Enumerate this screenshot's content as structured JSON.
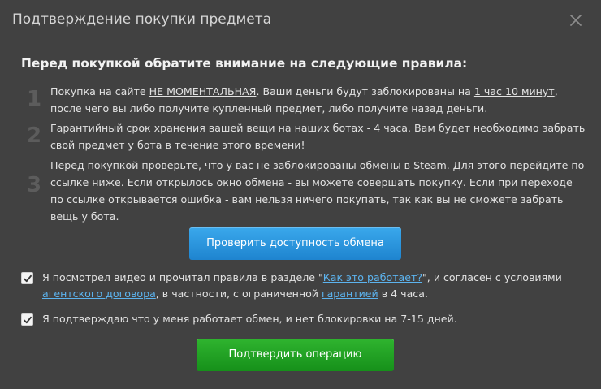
{
  "dialog": {
    "title": "Подтверждение покупки предмета",
    "close_icon": "close-icon"
  },
  "rules": {
    "heading": "Перед покупкой обратите внимание на следующие правила:",
    "items": [
      {
        "number": "1",
        "parts": [
          "Покупка на сайте ",
          "НЕ МОМЕНТАЛЬНАЯ",
          ". Ваши деньги будут заблокированы на ",
          "1 час 10 минут",
          ", после чего вы либо получите купленный предмет, либо получите назад деньги."
        ]
      },
      {
        "number": "2",
        "text": "Гарантийный срок хранения вашей вещи на наших ботах - 4 часа. Вам будет необходимо забрать свой предмет у бота в течение этого времени!"
      },
      {
        "number": "3",
        "text": "Перед покупкой проверьте, что у вас не заблокированы обмены в Steam. Для этого перейдите по ссылке ниже. Если открылось окно обмена - вы можете совершать покупку. Если при переходе по ссылке открывается ошибка - вам нельзя ничего покупать, так как вы не сможете забрать вещь у бота."
      }
    ]
  },
  "check_trade_button": "Проверить доступность обмена",
  "agreement": {
    "checked": true,
    "text_1": "Я посмотрел видео и прочитал правила в разделе \"",
    "link_how": "Как это работает?",
    "text_2": "\", и согласен с условиями ",
    "link_contract": "агентского договора",
    "text_3": ", в частности, с ограниченной ",
    "link_warranty": "гарантией",
    "text_4": " в 4 часа."
  },
  "trade_confirm": {
    "checked": true,
    "text": "Я подтверждаю что у меня работает обмен, и нет блокировки на 7-15 дней."
  },
  "confirm_button": "Подтвердить операцию",
  "colors": {
    "dialog_bg": "#414141",
    "primary_blue": "#2895de",
    "confirm_green": "#22a325",
    "link": "#5cb3ee"
  }
}
